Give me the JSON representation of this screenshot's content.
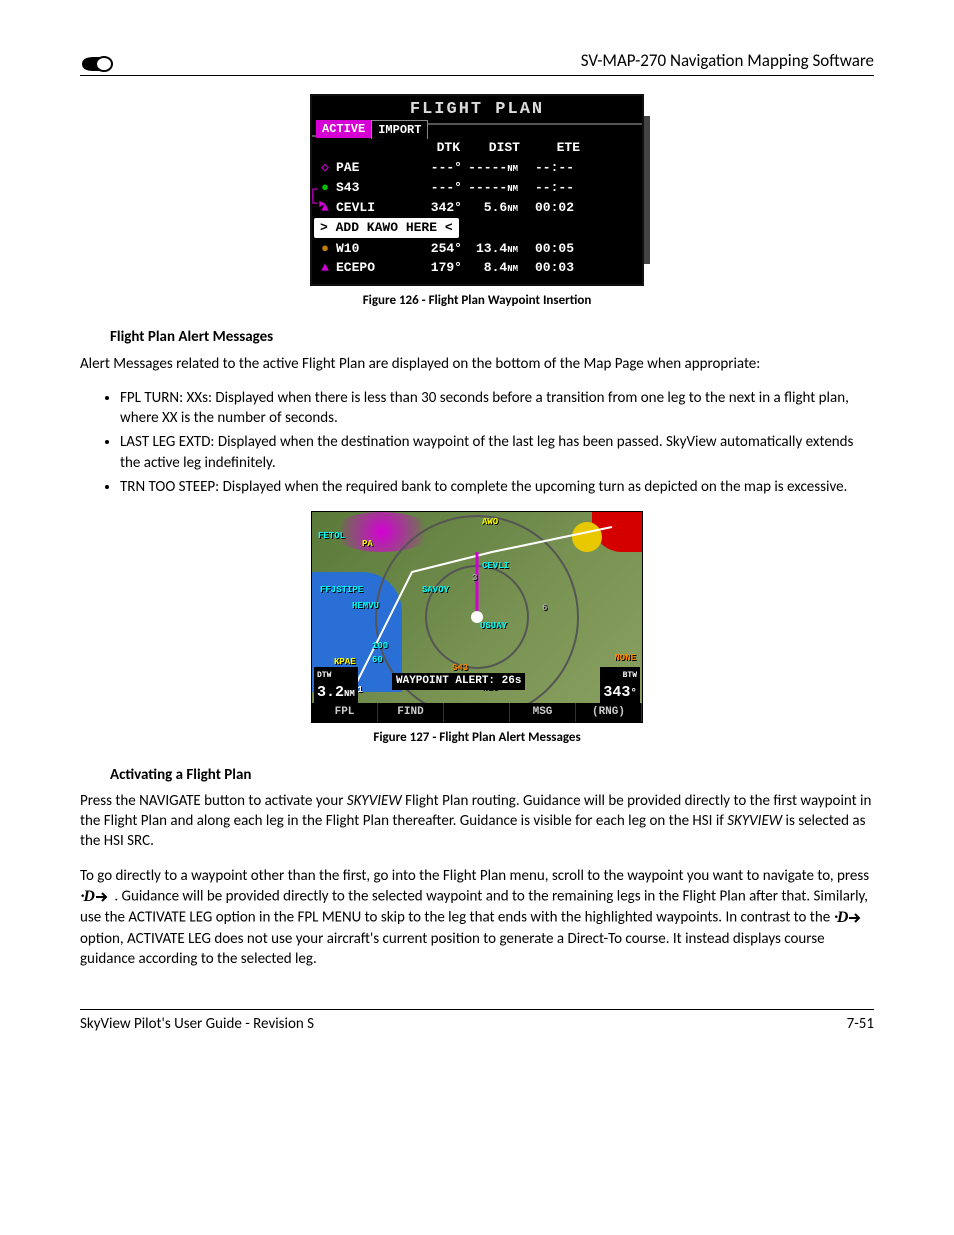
{
  "header": {
    "doc_title": "SV-MAP-270 Navigation Mapping Software"
  },
  "figure126": {
    "title": "FLIGHT PLAN",
    "tabs": {
      "active": "ACTIVE",
      "inactive": "IMPORT"
    },
    "cols": {
      "dtk": "DTK",
      "dist": "DIST",
      "ete": "ETE"
    },
    "rows": [
      {
        "icon": "◇",
        "icon_color": "#d400d4",
        "wp": "PAE",
        "dtk": "---°",
        "dist": "-----",
        "unit": "NM",
        "ete": "--:--"
      },
      {
        "icon": "●",
        "icon_color": "#00c000",
        "wp": "S43",
        "dtk": "---°",
        "dist": "-----",
        "unit": "NM",
        "ete": "--:--"
      },
      {
        "icon": "▲",
        "icon_color": "#d400d4",
        "wp": "CEVLI",
        "dtk": "342°",
        "dist": "5.6",
        "unit": "NM",
        "ete": "00:02"
      }
    ],
    "insert": "> ADD KAWO HERE <",
    "rows2": [
      {
        "icon": "●",
        "icon_color": "#c08000",
        "wp": "W10",
        "dtk": "254°",
        "dist": "13.4",
        "unit": "NM",
        "ete": "00:05"
      },
      {
        "icon": "▲",
        "icon_color": "#d400d4",
        "wp": "ECEPO",
        "dtk": "179°",
        "dist": "8.4",
        "unit": "NM",
        "ete": "00:03"
      }
    ],
    "caption": "Figure 126 - Flight Plan Waypoint Insertion"
  },
  "section_alert": {
    "heading": "Flight Plan Alert Messages",
    "intro": "Alert Messages related to the active Flight Plan are displayed on the bottom of the Map Page when appropriate:",
    "bullets": [
      "FPL TURN: XXs:  Displayed when there is less than 30 seconds before a transition from one leg to the next in a flight plan, where XX is the number of seconds.",
      "LAST LEG EXTD:  Displayed when the destination waypoint of the last leg has been passed. SkyView automatically extends the active leg indefinitely.",
      "TRN TOO STEEP:  Displayed when the required bank to complete the upcoming turn as depicted on the map is excessive."
    ]
  },
  "figure127": {
    "labels": {
      "fetol": "FETOL",
      "paba": "PA",
      "awo": "AWO",
      "cevli": "CEVLI",
      "savoy": "SAVOY",
      "hemvu": "HEMVU",
      "usuay": "USUAY",
      "kpae": "KPAE",
      "s43": "S43",
      "w16": "W16",
      "none": "NONE",
      "ffjstipe": "FFJSTIPE",
      "n3": "3",
      "n6": "6",
      "n100": "100",
      "n60": "60",
      "n31": "31"
    },
    "readouts": {
      "dtw_label": "DTW",
      "dtw": "3.2",
      "dtw_unit": "NM",
      "btw_label": "BTW",
      "btw": "343",
      "btw_unit": "°"
    },
    "alert": "WAYPOINT ALERT: 26s",
    "softkeys": {
      "fpl": "FPL",
      "find": "FIND",
      "blank": "",
      "msg": "MSG",
      "rng": "(RNG)"
    },
    "caption": "Figure 127 - Flight Plan Alert Messages"
  },
  "section_activate": {
    "heading": "Activating a Flight Plan",
    "p1a": "Press the NAVIGATE button to activate your ",
    "p1_skyview": "SKYVIEW",
    "p1b": " Flight Plan routing.  Guidance will be provided directly to the first waypoint in the Flight Plan and along each leg in the Flight Plan thereafter.  Guidance is visible for each leg on the HSI if ",
    "p1c": " is selected as the HSI SRC.",
    "p2a": "To go directly to a waypoint other than the first, go into the Flight Plan menu, scroll to the waypoint you want to navigate to, press ",
    "p2b": ".  Guidance will be provided directly to the selected waypoint and to the remaining legs in the Flight Plan after that.  Similarly, use the ACTIVATE LEG option in the FPL MENU to skip to the leg that ends with the highlighted waypoints. In contrast to the ",
    "p2c": " option, ACTIVATE LEG does not use your aircraft's current position to generate a Direct-To course. It instead displays course guidance according to the selected leg."
  },
  "footer": {
    "left": "SkyView Pilot's User Guide - Revision S",
    "right": "7-51"
  }
}
